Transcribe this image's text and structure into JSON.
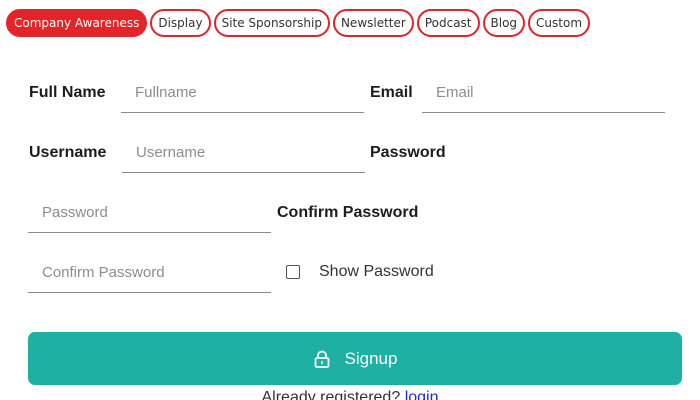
{
  "tabs": [
    {
      "label": "Company Awareness",
      "active": true
    },
    {
      "label": "Display",
      "active": false
    },
    {
      "label": "Site Sponsorship",
      "active": false
    },
    {
      "label": "Newsletter",
      "active": false
    },
    {
      "label": "Podcast",
      "active": false
    },
    {
      "label": "Blog",
      "active": false
    },
    {
      "label": "Custom",
      "active": false
    }
  ],
  "form": {
    "fullname_label": "Full Name",
    "fullname_placeholder": "Fullname",
    "email_label": "Email",
    "email_placeholder": "Email",
    "username_label": "Username",
    "username_placeholder": "Username",
    "password_label": "Password",
    "password_placeholder": "Password",
    "confirm_label": "Confirm Password",
    "confirm_placeholder": "Confirm Password",
    "show_password_label": "Show Password",
    "show_password_checked": false,
    "signup_label": "Signup",
    "signup_icon": "lock-icon",
    "signup_color": "#1fb0a4"
  },
  "footer": {
    "prompt": "Already registered?",
    "login_link": "login"
  },
  "colors": {
    "accent_red": "#e3242b",
    "link_blue": "#1a2fd0"
  }
}
